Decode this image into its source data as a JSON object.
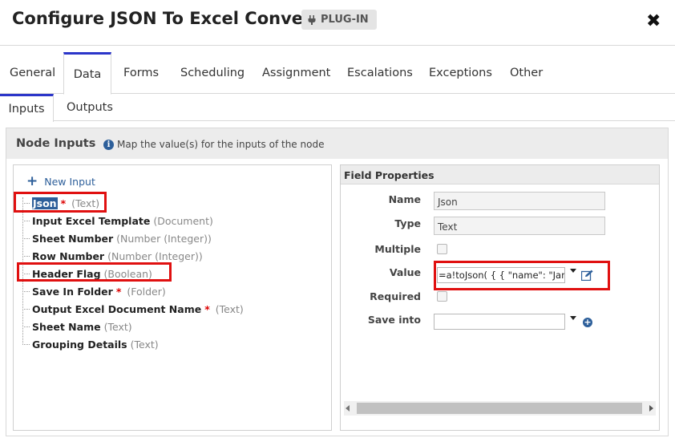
{
  "header": {
    "title": "Configure JSON To Excel Converter",
    "badge": "PLUG-IN",
    "close_symbol": "✖"
  },
  "tabs": [
    {
      "label": "General",
      "active": false
    },
    {
      "label": "Data",
      "active": true
    },
    {
      "label": "Forms",
      "active": false
    },
    {
      "label": "Scheduling",
      "active": false
    },
    {
      "label": "Assignment",
      "active": false
    },
    {
      "label": "Escalations",
      "active": false
    },
    {
      "label": "Exceptions",
      "active": false
    },
    {
      "label": "Other",
      "active": false
    }
  ],
  "subtabs": [
    {
      "label": "Inputs",
      "active": true
    },
    {
      "label": "Outputs",
      "active": false
    }
  ],
  "section": {
    "title": "Node Inputs",
    "hint": "Map the value(s) for the inputs of the node"
  },
  "tree": {
    "new_input_label": "New Input",
    "nodes": [
      {
        "name": "Json",
        "required": "*",
        "type": "(Text)",
        "selected": true
      },
      {
        "name": "Input Excel Template",
        "required": "",
        "type": "(Document)"
      },
      {
        "name": "Sheet Number",
        "required": "",
        "type": "(Number (Integer))"
      },
      {
        "name": "Row Number",
        "required": "",
        "type": "(Number (Integer))"
      },
      {
        "name": "Header Flag",
        "required": "",
        "type": "(Boolean)"
      },
      {
        "name": "Save In Folder",
        "required": "*",
        "type": "(Folder)"
      },
      {
        "name": "Output Excel Document Name",
        "required": "*",
        "type": "(Text)"
      },
      {
        "name": "Sheet Name",
        "required": "",
        "type": "(Text)"
      },
      {
        "name": "Grouping Details",
        "required": "",
        "type": "(Text)"
      }
    ]
  },
  "field_properties": {
    "title": "Field Properties",
    "name_label": "Name",
    "name_value": "Json",
    "type_label": "Type",
    "type_value": "Text",
    "multiple_label": "Multiple",
    "value_label": "Value",
    "value_text": "=a!toJson( {   { \"name\": \"Jane Doe\"",
    "required_label": "Required",
    "save_into_label": "Save into",
    "save_into_value": ""
  },
  "icons": {
    "badge": "plug-icon",
    "close": "close-icon",
    "info": "info-icon",
    "new_input": "plus-icon",
    "edit": "edit-icon",
    "add": "add-circle-icon"
  },
  "colors": {
    "accent": "#2b35c9",
    "link": "#2d5f9a",
    "highlight": "#e01010",
    "required": "#d00000"
  }
}
